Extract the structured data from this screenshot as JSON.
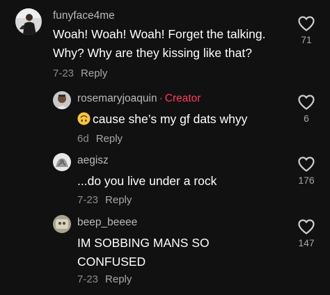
{
  "comments": [
    {
      "username": "funyface4me",
      "text_lines": [
        "Woah! Woah! Woah! Forget the talking.",
        "Why? Why are they kissing like that?"
      ],
      "date": "7-23",
      "reply_label": "Reply",
      "likes": "71",
      "icon": "heart-outline-icon"
    },
    {
      "username": "rosemaryjoaquin",
      "badge_separator": "·",
      "badge": "Creator",
      "emoji": "upside-down-face-emoji",
      "text": "cause she’s my gf dats whyy",
      "date": "6d",
      "reply_label": "Reply",
      "likes": "6",
      "icon": "heart-outline-icon"
    },
    {
      "username": "aegisz",
      "text": "...do you live under a rock",
      "date": "7-23",
      "reply_label": "Reply",
      "likes": "176",
      "icon": "heart-outline-icon"
    },
    {
      "username": "beep_beeee",
      "text_lines": [
        "IM SOBBING MANS SO",
        "CONFUSED"
      ],
      "date": "7-23",
      "reply_label": "Reply",
      "likes": "147",
      "icon": "heart-outline-icon"
    }
  ],
  "colors": {
    "background": "#111111",
    "creator_badge": "#ff3b5c",
    "secondary_text": "#a8a8a8"
  }
}
